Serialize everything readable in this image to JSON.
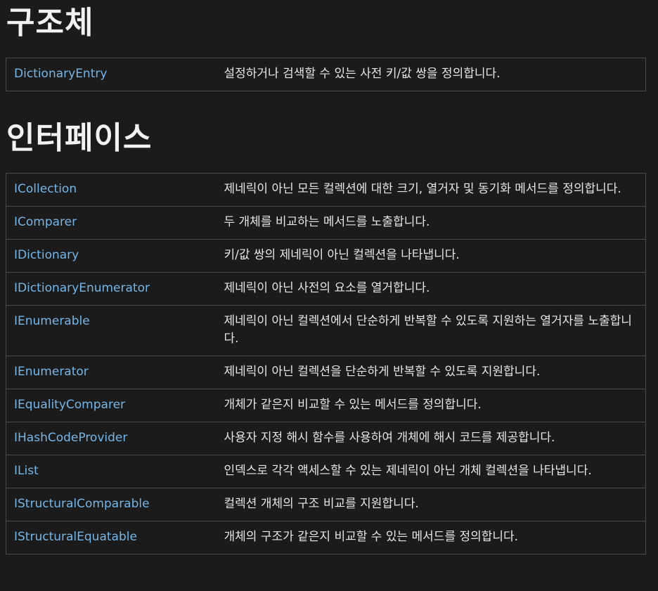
{
  "sections": {
    "structs": {
      "heading": "구조체",
      "rows": [
        {
          "name": "DictionaryEntry",
          "description": "설정하거나 검색할 수 있는 사전 키/값 쌍을 정의합니다."
        }
      ]
    },
    "interfaces": {
      "heading": "인터페이스",
      "rows": [
        {
          "name": "ICollection",
          "description": "제네릭이 아닌 모든 컬렉션에 대한 크기, 열거자 및 동기화 메서드를 정의합니다."
        },
        {
          "name": "IComparer",
          "description": "두 개체를 비교하는 메서드를 노출합니다."
        },
        {
          "name": "IDictionary",
          "description": "키/값 쌍의 제네릭이 아닌 컬렉션을 나타냅니다."
        },
        {
          "name": "IDictionaryEnumerator",
          "description": "제네릭이 아닌 사전의 요소를 열거합니다."
        },
        {
          "name": "IEnumerable",
          "description": "제네릭이 아닌 컬렉션에서 단순하게 반복할 수 있도록 지원하는 열거자를 노출합니다."
        },
        {
          "name": "IEnumerator",
          "description": "제네릭이 아닌 컬렉션을 단순하게 반복할 수 있도록 지원합니다."
        },
        {
          "name": "IEqualityComparer",
          "description": "개체가 같은지 비교할 수 있는 메서드를 정의합니다."
        },
        {
          "name": "IHashCodeProvider",
          "description": "사용자 지정 해시 함수를 사용하여 개체에 해시 코드를 제공합니다."
        },
        {
          "name": "IList",
          "description": "인덱스로 각각 액세스할 수 있는 제네릭이 아닌 개체 컬렉션을 나타냅니다."
        },
        {
          "name": "IStructuralComparable",
          "description": "컬렉션 개체의 구조 비교를 지원합니다."
        },
        {
          "name": "IStructuralEquatable",
          "description": "개체의 구조가 같은지 비교할 수 있는 메서드를 정의합니다."
        }
      ]
    }
  }
}
